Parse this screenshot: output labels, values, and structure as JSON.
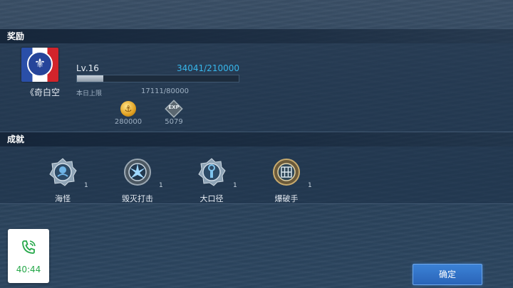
{
  "reward": {
    "header": "奖励",
    "ship_name": "《奇白空",
    "level": "Lv.16",
    "exp_progress": "34041/210000",
    "exp_fraction": 0.162,
    "daily_label": "本日上限",
    "daily_value": "17111/80000",
    "items": [
      {
        "icon": "gold-coin-icon",
        "value": "280000"
      },
      {
        "icon": "exp-icon",
        "label": "EXP",
        "value": "5079"
      }
    ]
  },
  "achievements": {
    "header": "成就",
    "items": [
      {
        "icon": "sea-monster-medal-icon",
        "name": "海怪",
        "count": "1"
      },
      {
        "icon": "destroy-strike-medal-icon",
        "name": "毁灭打击",
        "count": "1"
      },
      {
        "icon": "big-caliber-medal-icon",
        "name": "大口径",
        "count": "1"
      },
      {
        "icon": "demolition-medal-icon",
        "name": "爆破手",
        "count": "1"
      }
    ]
  },
  "call": {
    "time": "40:44"
  },
  "confirm_label": "确定",
  "colors": {
    "accent": "#37b6ea",
    "button": "#2f6ec4",
    "call_green": "#26a84a"
  }
}
